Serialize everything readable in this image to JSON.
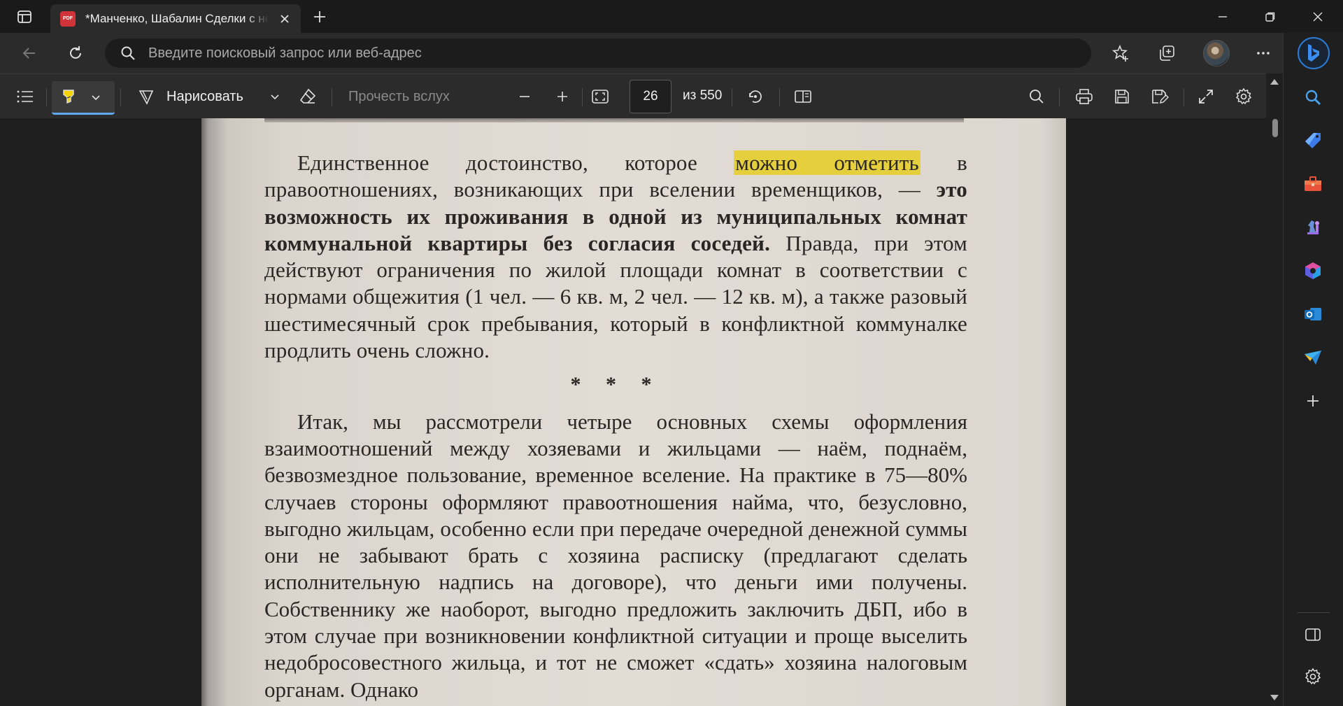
{
  "browser": {
    "tab": {
      "title": "*Манченко, Шабалин Сделки с недвижимостью",
      "badge": "PDF"
    },
    "address": {
      "placeholder": "Введите поисковый запрос или веб-адрес"
    }
  },
  "pdf_toolbar": {
    "draw_label": "Нарисовать",
    "read_aloud_label": "Прочесть вслух",
    "page_current": "26",
    "page_total_label": "из 550"
  },
  "document": {
    "para1_start": "Единственное достоинство, которое ",
    "para1_highlight": "можно отметить",
    "para1_mid": " в правоотношениях, возникающих при вселении временщиков, — ",
    "para1_bold": "это возможность их проживания в одной из муниципальных комнат коммунальной квартиры без согласия соседей.",
    "para1_end": " Правда, при этом действуют ограничения по жилой площади комнат в соответствии с нормами общежития (1 чел. — 6 кв. м, 2 чел. — 12 кв. м), а также разовый шестимесячный срок пребывания, который в конфликтной коммуналке продлить очень сложно.",
    "separator": "* * *",
    "para2": "Итак, мы рассмотрели четыре основных схемы оформления взаимоотношений между хозяевами и жильцами — наём, поднаём, безвозмездное пользование, временное вселение. На практике в 75—80% случаев стороны оформляют правоотношения найма, что, безусловно, выгодно жильцам, особенно если при передаче очередной денежной суммы они не забывают брать с хозяина расписку (предлагают сделать исполнительную надпись на договоре), что деньги ими получены. Собственнику же наоборот, выгодно предложить заключить ДБП, ибо в этом случае при возникновении конфликтной ситуации и проще выселить недобросовестного жильца, и тот не сможет «сдать» хозяина налоговым органам. Однако"
  },
  "colors": {
    "highlight": "#e6cf3c",
    "accent": "#5fa8f0",
    "bing": "#2b7cd8"
  }
}
